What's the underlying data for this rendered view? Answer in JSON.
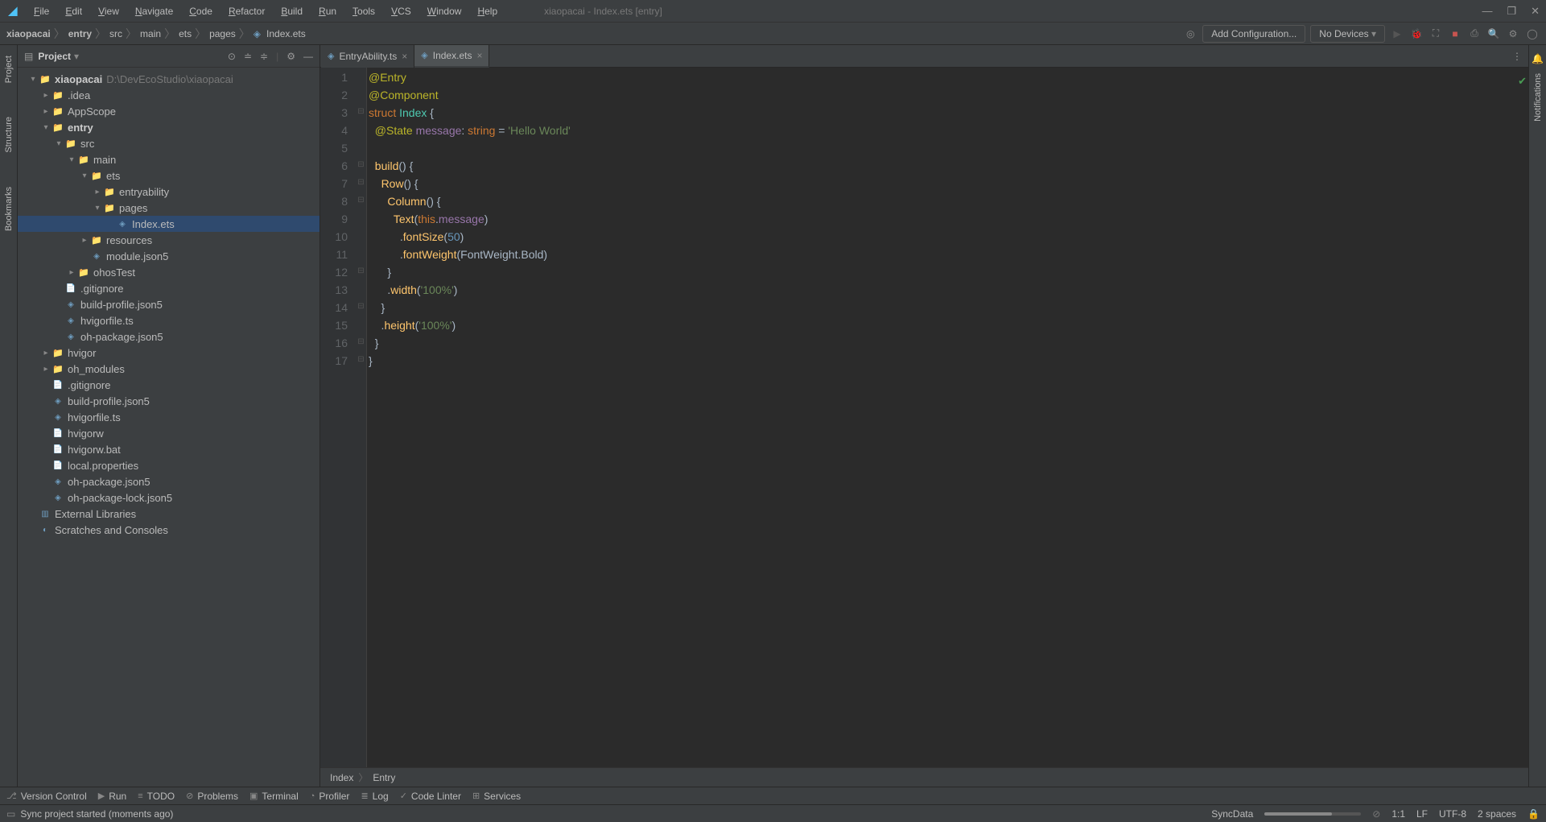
{
  "window": {
    "title": "xiaopacai - Index.ets [entry]"
  },
  "menu": [
    "File",
    "Edit",
    "View",
    "Navigate",
    "Code",
    "Refactor",
    "Build",
    "Run",
    "Tools",
    "VCS",
    "Window",
    "Help"
  ],
  "breadcrumb": [
    "xiaopacai",
    "entry",
    "src",
    "main",
    "ets",
    "pages",
    "Index.ets"
  ],
  "nav": {
    "add_config": "Add Configuration...",
    "devices": "No Devices"
  },
  "panel": {
    "title": "Project"
  },
  "tree": [
    {
      "depth": 0,
      "arrow": "▾",
      "icon": "module",
      "label": "xiaopacai",
      "bold": true,
      "extra": "D:\\DevEcoStudio\\xiaopacai"
    },
    {
      "depth": 1,
      "arrow": "▸",
      "icon": "folder",
      "label": ".idea"
    },
    {
      "depth": 1,
      "arrow": "▸",
      "icon": "folder",
      "label": "AppScope"
    },
    {
      "depth": 1,
      "arrow": "▾",
      "icon": "module",
      "label": "entry",
      "bold": true
    },
    {
      "depth": 2,
      "arrow": "▾",
      "icon": "folder",
      "label": "src"
    },
    {
      "depth": 3,
      "arrow": "▾",
      "icon": "folder",
      "label": "main"
    },
    {
      "depth": 4,
      "arrow": "▾",
      "icon": "folder",
      "label": "ets"
    },
    {
      "depth": 5,
      "arrow": "▸",
      "icon": "folder",
      "label": "entryability"
    },
    {
      "depth": 5,
      "arrow": "▾",
      "icon": "folder",
      "label": "pages"
    },
    {
      "depth": 6,
      "arrow": "",
      "icon": "ets",
      "label": "Index.ets",
      "selected": true
    },
    {
      "depth": 4,
      "arrow": "▸",
      "icon": "folder",
      "label": "resources"
    },
    {
      "depth": 4,
      "arrow": "",
      "icon": "json",
      "label": "module.json5"
    },
    {
      "depth": 3,
      "arrow": "▸",
      "icon": "folder",
      "label": "ohosTest"
    },
    {
      "depth": 2,
      "arrow": "",
      "icon": "file",
      "label": ".gitignore"
    },
    {
      "depth": 2,
      "arrow": "",
      "icon": "json",
      "label": "build-profile.json5"
    },
    {
      "depth": 2,
      "arrow": "",
      "icon": "ts",
      "label": "hvigorfile.ts"
    },
    {
      "depth": 2,
      "arrow": "",
      "icon": "json",
      "label": "oh-package.json5"
    },
    {
      "depth": 1,
      "arrow": "▸",
      "icon": "folder",
      "label": "hvigor"
    },
    {
      "depth": 1,
      "arrow": "▸",
      "icon": "folder",
      "label": "oh_modules"
    },
    {
      "depth": 1,
      "arrow": "",
      "icon": "file",
      "label": ".gitignore"
    },
    {
      "depth": 1,
      "arrow": "",
      "icon": "json",
      "label": "build-profile.json5"
    },
    {
      "depth": 1,
      "arrow": "",
      "icon": "ts",
      "label": "hvigorfile.ts"
    },
    {
      "depth": 1,
      "arrow": "",
      "icon": "file",
      "label": "hvigorw"
    },
    {
      "depth": 1,
      "arrow": "",
      "icon": "file",
      "label": "hvigorw.bat"
    },
    {
      "depth": 1,
      "arrow": "",
      "icon": "file",
      "label": "local.properties"
    },
    {
      "depth": 1,
      "arrow": "",
      "icon": "json",
      "label": "oh-package.json5"
    },
    {
      "depth": 1,
      "arrow": "",
      "icon": "json",
      "label": "oh-package-lock.json5"
    },
    {
      "depth": 0,
      "arrow": "",
      "icon": "lib",
      "label": "External Libraries"
    },
    {
      "depth": 0,
      "arrow": "",
      "icon": "scratch",
      "label": "Scratches and Consoles"
    }
  ],
  "tabs": [
    {
      "label": "EntryAbility.ts",
      "active": false
    },
    {
      "label": "Index.ets",
      "active": true
    }
  ],
  "code_lines": [
    [
      {
        "t": "@Entry",
        "c": "c-anno"
      }
    ],
    [
      {
        "t": "@Component",
        "c": "c-anno"
      }
    ],
    [
      {
        "t": "struct ",
        "c": "c-kw"
      },
      {
        "t": "Index ",
        "c": "c-struct"
      },
      {
        "t": "{",
        "c": "c-punct"
      }
    ],
    [
      {
        "t": "  ",
        "c": ""
      },
      {
        "t": "@State ",
        "c": "c-anno"
      },
      {
        "t": "message",
        "c": "c-member"
      },
      {
        "t": ": ",
        "c": "c-punct"
      },
      {
        "t": "string ",
        "c": "c-kw"
      },
      {
        "t": "= ",
        "c": "c-punct"
      },
      {
        "t": "'Hello World'",
        "c": "c-str"
      }
    ],
    [],
    [
      {
        "t": "  ",
        "c": ""
      },
      {
        "t": "build",
        "c": "c-method"
      },
      {
        "t": "() {",
        "c": "c-punct"
      }
    ],
    [
      {
        "t": "    ",
        "c": ""
      },
      {
        "t": "Row",
        "c": "c-method"
      },
      {
        "t": "() {",
        "c": "c-punct"
      }
    ],
    [
      {
        "t": "      ",
        "c": ""
      },
      {
        "t": "Column",
        "c": "c-method"
      },
      {
        "t": "() {",
        "c": "c-punct"
      }
    ],
    [
      {
        "t": "        ",
        "c": ""
      },
      {
        "t": "Text",
        "c": "c-method"
      },
      {
        "t": "(",
        "c": "c-punct"
      },
      {
        "t": "this",
        "c": "c-kw"
      },
      {
        "t": ".",
        "c": "c-punct"
      },
      {
        "t": "message",
        "c": "c-member"
      },
      {
        "t": ")",
        "c": "c-punct"
      }
    ],
    [
      {
        "t": "          .",
        "c": "c-punct"
      },
      {
        "t": "fontSize",
        "c": "c-method"
      },
      {
        "t": "(",
        "c": "c-punct"
      },
      {
        "t": "50",
        "c": "c-num"
      },
      {
        "t": ")",
        "c": "c-punct"
      }
    ],
    [
      {
        "t": "          .",
        "c": "c-punct"
      },
      {
        "t": "fontWeight",
        "c": "c-method"
      },
      {
        "t": "(",
        "c": "c-punct"
      },
      {
        "t": "FontWeight",
        "c": "c-id"
      },
      {
        "t": ".",
        "c": "c-punct"
      },
      {
        "t": "Bold",
        "c": "c-id"
      },
      {
        "t": ")",
        "c": "c-punct"
      }
    ],
    [
      {
        "t": "      }",
        "c": "c-punct"
      }
    ],
    [
      {
        "t": "      .",
        "c": "c-punct"
      },
      {
        "t": "width",
        "c": "c-method"
      },
      {
        "t": "(",
        "c": "c-punct"
      },
      {
        "t": "'100%'",
        "c": "c-str"
      },
      {
        "t": ")",
        "c": "c-punct"
      }
    ],
    [
      {
        "t": "    }",
        "c": "c-punct"
      }
    ],
    [
      {
        "t": "    .",
        "c": "c-punct"
      },
      {
        "t": "height",
        "c": "c-method"
      },
      {
        "t": "(",
        "c": "c-punct"
      },
      {
        "t": "'100%'",
        "c": "c-str"
      },
      {
        "t": ")",
        "c": "c-punct"
      }
    ],
    [
      {
        "t": "  }",
        "c": "c-punct"
      }
    ],
    [
      {
        "t": "}",
        "c": "c-punct"
      }
    ]
  ],
  "editor_crumbs": [
    "Index",
    "Entry"
  ],
  "bottom_tabs": [
    {
      "icon": "⎇",
      "label": "Version Control"
    },
    {
      "icon": "▶",
      "label": "Run"
    },
    {
      "icon": "≡",
      "label": "TODO"
    },
    {
      "icon": "⊘",
      "label": "Problems"
    },
    {
      "icon": "▣",
      "label": "Terminal"
    },
    {
      "icon": "◔",
      "label": "Profiler"
    },
    {
      "icon": "≣",
      "label": "Log"
    },
    {
      "icon": "✓",
      "label": "Code Linter"
    },
    {
      "icon": "⊞",
      "label": "Services"
    }
  ],
  "status": {
    "message": "Sync project started (moments ago)",
    "sync": "SyncData",
    "pos": "1:1",
    "lf": "LF",
    "enc": "UTF-8",
    "indent": "2 spaces"
  },
  "left_rail": [
    "Project",
    "Structure",
    "Bookmarks"
  ],
  "right_rail": [
    "Notifications"
  ]
}
